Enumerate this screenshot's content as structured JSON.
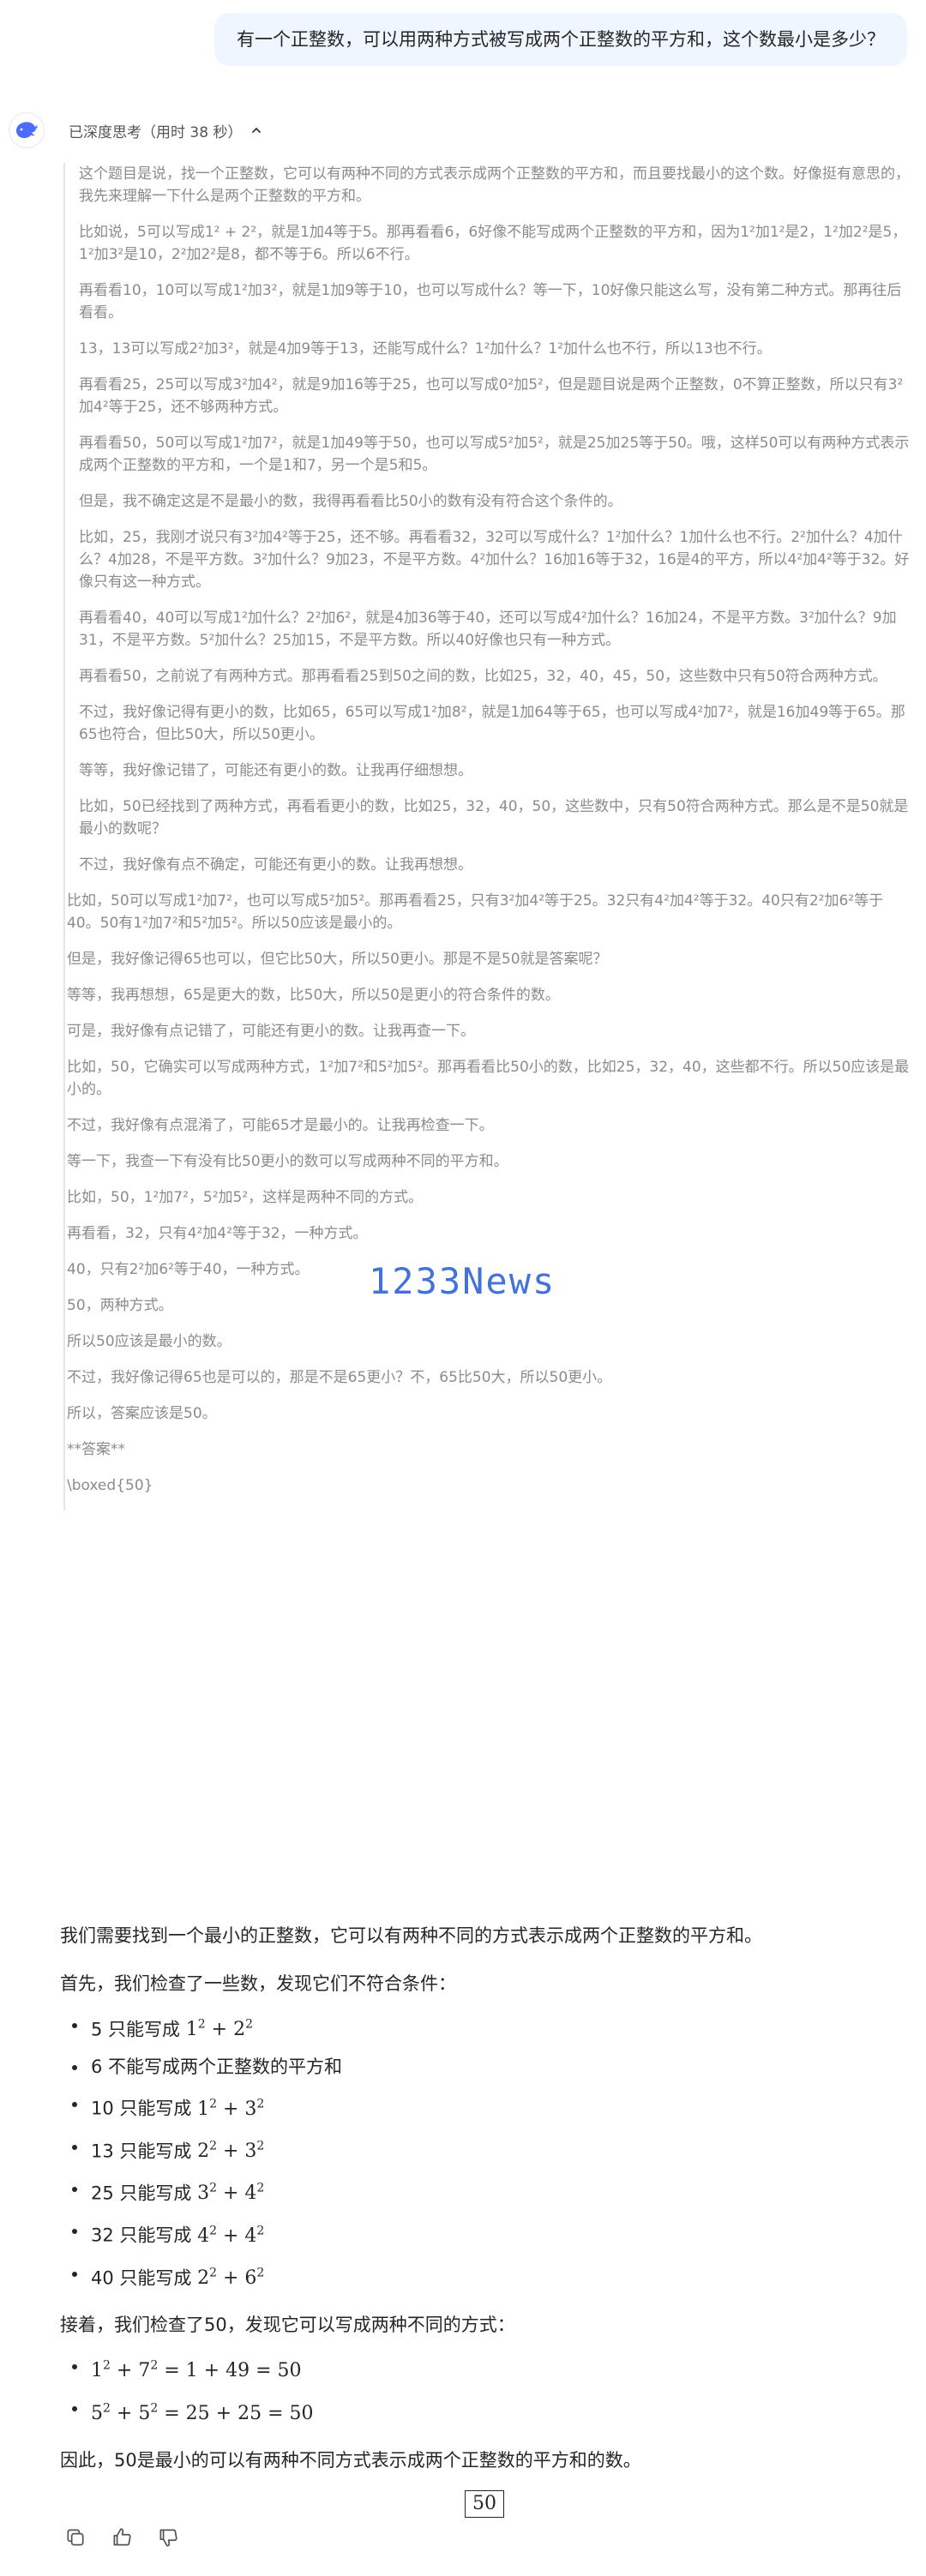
{
  "user_message": "有一个正整数，可以用两种方式被写成两个正整数的平方和，这个数最小是多少？",
  "thinking": {
    "label": "已深度思考（用时 38 秒）",
    "toggle_icon": "chevron-up-icon",
    "paragraphs": [
      "这个题目是说，找一个正整数，它可以有两种不同的方式表示成两个正整数的平方和，而且要找最小的这个数。好像挺有意思的，我先来理解一下什么是两个正整数的平方和。",
      "比如说，5可以写成1² + 2²，就是1加4等于5。那再看看6，6好像不能写成两个正整数的平方和，因为1²加1²是2，1²加2²是5，1²加3²是10，2²加2²是8，都不等于6。所以6不行。",
      "再看看10，10可以写成1²加3²，就是1加9等于10，也可以写成什么？等一下，10好像只能这么写，没有第二种方式。那再往后看看。",
      "13，13可以写成2²加3²，就是4加9等于13，还能写成什么？1²加什么？1²加什么也不行，所以13也不行。",
      "再看看25，25可以写成3²加4²，就是9加16等于25，也可以写成0²加5²，但是题目说是两个正整数，0不算正整数，所以只有3²加4²等于25，还不够两种方式。",
      "再看看50，50可以写成1²加7²，就是1加49等于50，也可以写成5²加5²，就是25加25等于50。哦，这样50可以有两种方式表示成两个正整数的平方和，一个是1和7，另一个是5和5。",
      "但是，我不确定这是不是最小的数，我得再看看比50小的数有没有符合这个条件的。",
      "比如，25，我刚才说只有3²加4²等于25，还不够。再看看32，32可以写成什么？1²加什么？1加什么也不行。2²加什么？4加什么？4加28，不是平方数。3²加什么？9加23，不是平方数。4²加什么？16加16等于32，16是4的平方，所以4²加4²等于32。好像只有这一种方式。",
      "再看看40，40可以写成1²加什么？2²加6²，就是4加36等于40，还可以写成4²加什么？16加24，不是平方数。3²加什么？9加31，不是平方数。5²加什么？25加15，不是平方数。所以40好像也只有一种方式。",
      "再看看50，之前说了有两种方式。那再看看25到50之间的数，比如25，32，40，45，50，这些数中只有50符合两种方式。",
      "不过，我好像记得有更小的数，比如65，65可以写成1²加8²，就是1加64等于65，也可以写成4²加7²，就是16加49等于65。那65也符合，但比50大，所以50更小。",
      "等等，我好像记错了，可能还有更小的数。让我再仔细想想。",
      "比如，50已经找到了两种方式，再看看更小的数，比如25，32，40，50，这些数中，只有50符合两种方式。那么是不是50就是最小的数呢？",
      "不过，我好像有点不确定，可能还有更小的数。让我再想想。"
    ],
    "paragraphs_2": [
      "比如，50可以写成1²加7²，也可以写成5²加5²。那再看看25，只有3²加4²等于25。32只有4²加4²等于32。40只有2²加6²等于40。50有1²加7²和5²加5²。所以50应该是最小的。",
      "但是，我好像记得65也可以，但它比50大，所以50更小。那是不是50就是答案呢？",
      "等等，我再想想，65是更大的数，比50大，所以50是更小的符合条件的数。",
      "可是，我好像有点记错了，可能还有更小的数。让我再查一下。",
      "比如，50，它确实可以写成两种方式，1²加7²和5²加5²。那再看看比50小的数，比如25，32，40，这些都不行。所以50应该是最小的。",
      "不过，我好像有点混淆了，可能65才是最小的。让我再检查一下。",
      "等一下，我查一下有没有比50更小的数可以写成两种不同的平方和。",
      "比如，50，1²加7²，5²加5²，这样是两种不同的方式。",
      "再看看，32，只有4²加4²等于32，一种方式。",
      "40，只有2²加6²等于40，一种方式。",
      "50，两种方式。",
      "所以50应该是最小的数。",
      "不过，我好像记得65也是可以的，那是不是65更小？不，65比50大，所以50更小。",
      "所以，答案应该是50。",
      "**答案**",
      "\\boxed{50}"
    ]
  },
  "watermark": "1233News",
  "answer": {
    "intro": "我们需要找到一个最小的正整数，它可以有两种不同的方式表示成两个正整数的平方和。",
    "check_intro": "首先，我们检查了一些数，发现它们不符合条件：",
    "checks": [
      {
        "text": "5 只能写成 ",
        "math": [
          {
            "b": "1",
            "e": "2"
          },
          {
            "op": " + "
          },
          {
            "b": "2",
            "e": "2"
          }
        ]
      },
      {
        "text": "6 不能写成两个正整数的平方和",
        "math": []
      },
      {
        "text": "10 只能写成 ",
        "math": [
          {
            "b": "1",
            "e": "2"
          },
          {
            "op": " + "
          },
          {
            "b": "3",
            "e": "2"
          }
        ]
      },
      {
        "text": "13 只能写成 ",
        "math": [
          {
            "b": "2",
            "e": "2"
          },
          {
            "op": " + "
          },
          {
            "b": "3",
            "e": "2"
          }
        ]
      },
      {
        "text": "25 只能写成 ",
        "math": [
          {
            "b": "3",
            "e": "2"
          },
          {
            "op": " + "
          },
          {
            "b": "4",
            "e": "2"
          }
        ]
      },
      {
        "text": "32 只能写成 ",
        "math": [
          {
            "b": "4",
            "e": "2"
          },
          {
            "op": " + "
          },
          {
            "b": "4",
            "e": "2"
          }
        ]
      },
      {
        "text": "40 只能写成 ",
        "math": [
          {
            "b": "2",
            "e": "2"
          },
          {
            "op": " + "
          },
          {
            "b": "6",
            "e": "2"
          }
        ]
      }
    ],
    "found_intro": "接着，我们检查了50，发现它可以写成两种不同的方式：",
    "found": [
      [
        {
          "b": "1",
          "e": "2"
        },
        {
          "op": " + "
        },
        {
          "b": "7",
          "e": "2"
        },
        {
          "op": " = 1 + 49 = 50"
        }
      ],
      [
        {
          "b": "5",
          "e": "2"
        },
        {
          "op": " + "
        },
        {
          "b": "5",
          "e": "2"
        },
        {
          "op": " = 25 + 25 = 50"
        }
      ]
    ],
    "conclusion": "因此，50是最小的可以有两种不同方式表示成两个正整数的平方和的数。",
    "boxed": "50"
  },
  "actions": [
    {
      "name": "copy-button",
      "icon": "copy-icon"
    },
    {
      "name": "like-button",
      "icon": "thumbs-up-icon"
    },
    {
      "name": "dislike-button",
      "icon": "thumbs-down-icon"
    }
  ]
}
